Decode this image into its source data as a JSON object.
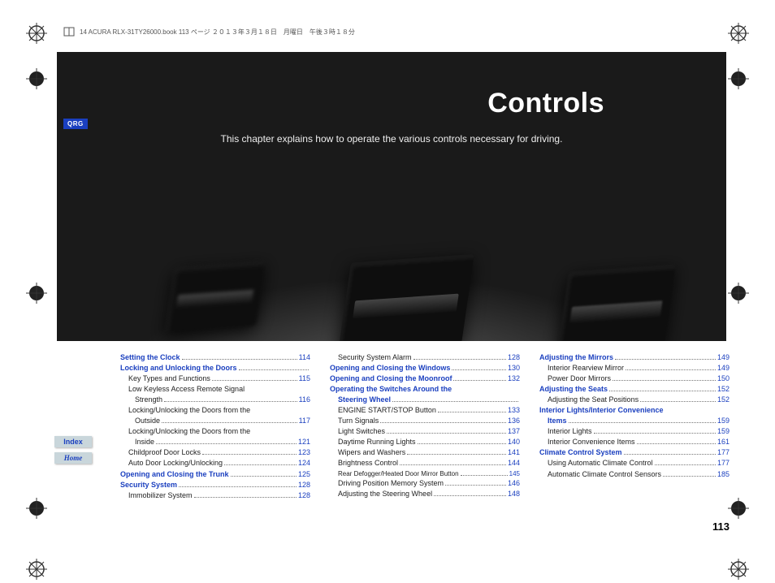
{
  "header_trace": "14 ACURA RLX-31TY26000.book  113 ページ  ２０１３年３月１８日　月曜日　午後３時１８分",
  "side": {
    "qrg": "QRG",
    "index": "Index",
    "home": "Home"
  },
  "hero": {
    "title": "Controls",
    "subtitle": "This chapter explains how to operate the various controls necessary for driving."
  },
  "page_number": "113",
  "toc": {
    "col1": [
      {
        "label": "Setting the Clock",
        "page": "114",
        "head": true
      },
      {
        "label": "Locking and Unlocking the Doors",
        "page": "",
        "head": true
      },
      {
        "label": "Key Types and Functions",
        "page": "115",
        "indent": 1
      },
      {
        "label": "Low Keyless Access Remote Signal",
        "indent": 1,
        "cont": true
      },
      {
        "label": "Strength",
        "page": "116",
        "indent": 2
      },
      {
        "label": "Locking/Unlocking the Doors from the",
        "indent": 1,
        "cont": true
      },
      {
        "label": "Outside",
        "page": "117",
        "indent": 2
      },
      {
        "label": "Locking/Unlocking the Doors from the",
        "indent": 1,
        "cont": true
      },
      {
        "label": "Inside",
        "page": "121",
        "indent": 2
      },
      {
        "label": "Childproof Door Locks",
        "page": "123",
        "indent": 1
      },
      {
        "label": "Auto Door Locking/Unlocking",
        "page": "124",
        "indent": 1
      },
      {
        "label": "Opening and Closing the Trunk",
        "page": "125",
        "head": true
      },
      {
        "label": "Security System",
        "page": "128",
        "head": true
      },
      {
        "label": "Immobilizer System",
        "page": "128",
        "indent": 1
      }
    ],
    "col2": [
      {
        "label": "Security System Alarm",
        "page": "128",
        "indent": 1
      },
      {
        "label": "Opening and Closing the Windows",
        "page": "130",
        "head": true
      },
      {
        "label": "Opening and Closing the Moonroof",
        "page": "132",
        "head": true
      },
      {
        "label": "Operating the Switches Around the",
        "head": true,
        "cont": true
      },
      {
        "label": "Steering Wheel",
        "page": "",
        "head": true,
        "indent": 1
      },
      {
        "label": "ENGINE START/STOP Button",
        "page": "133",
        "indent": 1
      },
      {
        "label": "Turn Signals",
        "page": "136",
        "indent": 1
      },
      {
        "label": "Light Switches",
        "page": "137",
        "indent": 1
      },
      {
        "label": "Daytime Running Lights",
        "page": "140",
        "indent": 1
      },
      {
        "label": "Wipers and Washers",
        "page": "141",
        "indent": 1
      },
      {
        "label": "Brightness Control",
        "page": "144",
        "indent": 1
      },
      {
        "label": "Rear Defogger/Heated Door Mirror Button",
        "page": "145",
        "indent": 1,
        "tight": true
      },
      {
        "label": "Driving Position Memory System",
        "page": "146",
        "indent": 1
      },
      {
        "label": "Adjusting the Steering Wheel",
        "page": "148",
        "indent": 1
      }
    ],
    "col3": [
      {
        "label": "Adjusting the Mirrors",
        "page": "149",
        "head": true
      },
      {
        "label": "Interior Rearview Mirror",
        "page": "149",
        "indent": 1
      },
      {
        "label": "Power Door Mirrors",
        "page": "150",
        "indent": 1
      },
      {
        "label": "Adjusting the Seats",
        "page": "152",
        "head": true
      },
      {
        "label": "Adjusting the Seat Positions",
        "page": "152",
        "indent": 1
      },
      {
        "label": "Interior Lights/Interior Convenience",
        "head": true,
        "cont": true
      },
      {
        "label": "Items",
        "page": "159",
        "head": true,
        "indent": 1
      },
      {
        "label": "Interior Lights",
        "page": "159",
        "indent": 1
      },
      {
        "label": "Interior Convenience Items",
        "page": "161",
        "indent": 1
      },
      {
        "label": "Climate Control System",
        "page": "177",
        "head": true
      },
      {
        "label": "Using Automatic Climate Control",
        "page": "177",
        "indent": 1
      },
      {
        "label": "Automatic Climate Control Sensors",
        "page": "185",
        "indent": 1
      }
    ]
  }
}
